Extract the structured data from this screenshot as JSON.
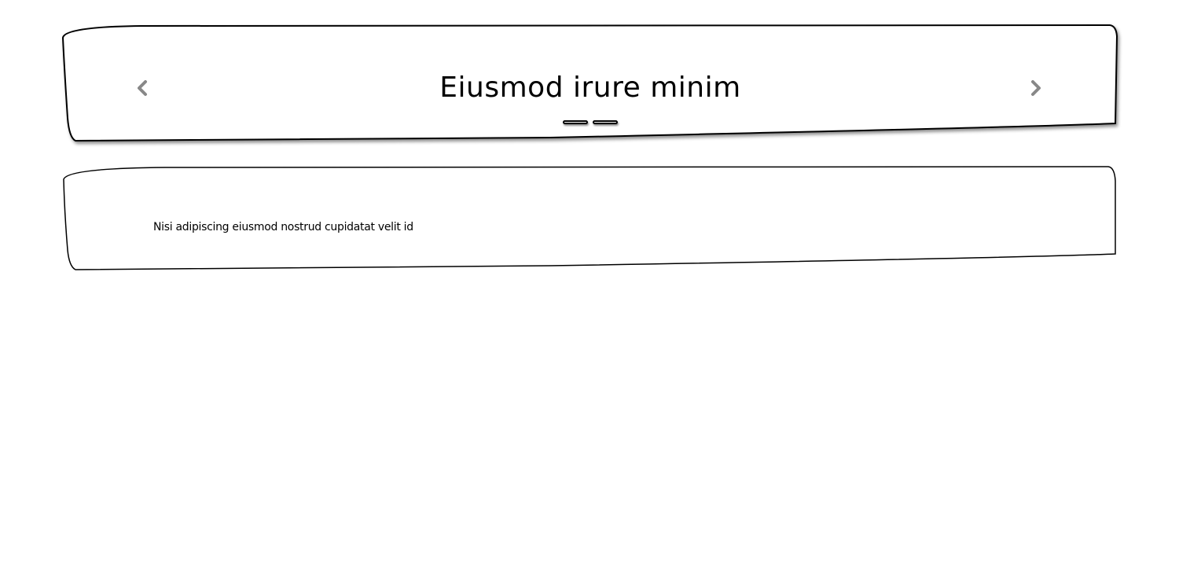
{
  "carousel": {
    "title": "Eiusmod irure minim",
    "prev_icon": "chevron-left-icon",
    "next_icon": "chevron-right-icon",
    "indicator_count": 2,
    "arrow_color": "#888888"
  },
  "card": {
    "text": "Nisi adipiscing eiusmod nostrud cupidatat velit id"
  }
}
